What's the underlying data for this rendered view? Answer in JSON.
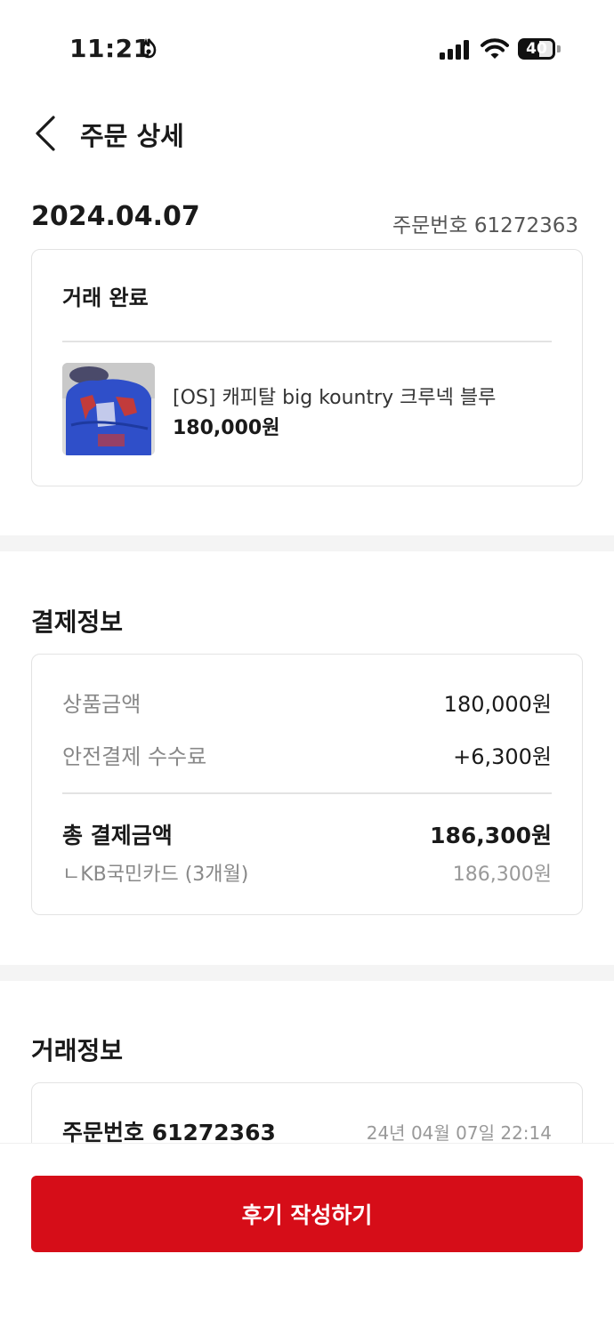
{
  "status_bar": {
    "time": "11:21",
    "battery": "40"
  },
  "header": {
    "title": "주문 상세"
  },
  "order": {
    "date": "2024.04.07",
    "order_number_label": "주문번호 61272363"
  },
  "status_card": {
    "status": "거래 완료",
    "product": {
      "name": "[OS] 캐피탈 big kountry 크루넥 블루",
      "price": "180,000원"
    }
  },
  "payment": {
    "section_title": "결제정보",
    "product_amount_label": "상품금액",
    "product_amount_value": "180,000원",
    "fee_label": "안전결제 수수료",
    "fee_value": "+6,300원",
    "total_label": "총 결제금액",
    "total_value": "186,300원",
    "method_label": "ㄴKB국민카드 (3개월)",
    "method_value": "186,300원"
  },
  "trade": {
    "section_title": "거래정보",
    "order_number": "주문번호 61272363",
    "datetime": "24년 04월 07일 22:14"
  },
  "bottom": {
    "review_button": "후기 작성하기"
  },
  "colors": {
    "accent": "#d60d18",
    "border": "#e3e3e3",
    "muted_text": "#888888"
  },
  "icons": {
    "back": "chevron-left-icon",
    "signal": "cellular-signal-icon",
    "wifi": "wifi-icon",
    "battery": "battery-icon"
  }
}
